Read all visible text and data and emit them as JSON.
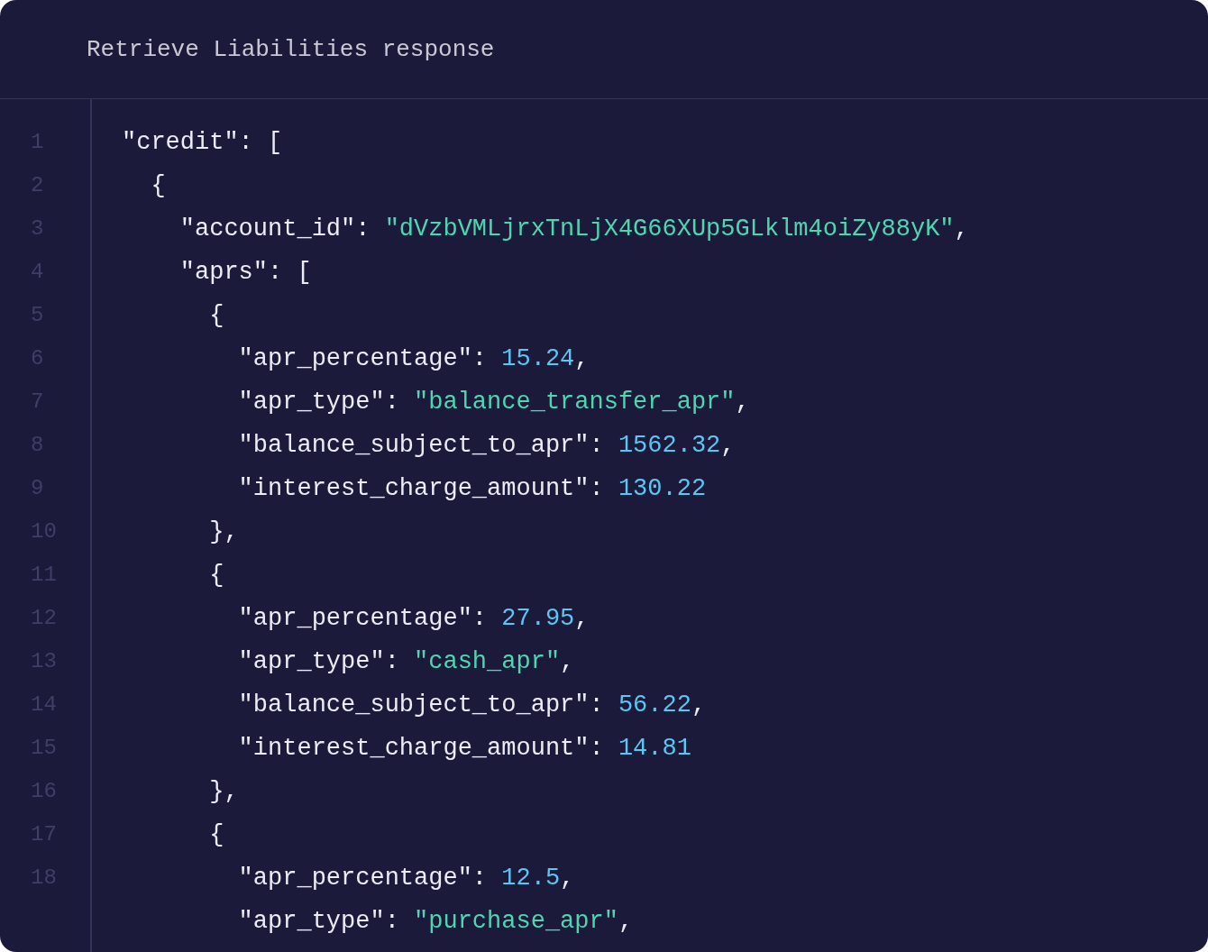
{
  "window": {
    "title": "Retrieve Liabilities response"
  },
  "code_lines": [
    {
      "number": "1",
      "tokens": [
        {
          "kind": "plain",
          "text": "\"credit\": ["
        }
      ]
    },
    {
      "number": "2",
      "tokens": [
        {
          "kind": "plain",
          "text": "  {"
        }
      ]
    },
    {
      "number": "3",
      "tokens": [
        {
          "kind": "plain",
          "text": "    \"account_id\": "
        },
        {
          "kind": "string",
          "text": "\"dVzbVMLjrxTnLjX4G66XUp5GLklm4oiZy88yK\""
        },
        {
          "kind": "plain",
          "text": ","
        }
      ]
    },
    {
      "number": "4",
      "tokens": [
        {
          "kind": "plain",
          "text": "    \"aprs\": ["
        }
      ]
    },
    {
      "number": "5",
      "tokens": [
        {
          "kind": "plain",
          "text": "      {"
        }
      ]
    },
    {
      "number": "6",
      "tokens": [
        {
          "kind": "plain",
          "text": "        \"apr_percentage\": "
        },
        {
          "kind": "number",
          "text": "15.24"
        },
        {
          "kind": "plain",
          "text": ","
        }
      ]
    },
    {
      "number": "7",
      "tokens": [
        {
          "kind": "plain",
          "text": "        \"apr_type\": "
        },
        {
          "kind": "string",
          "text": "\"balance_transfer_apr\""
        },
        {
          "kind": "plain",
          "text": ","
        }
      ]
    },
    {
      "number": "8",
      "tokens": [
        {
          "kind": "plain",
          "text": "        \"balance_subject_to_apr\": "
        },
        {
          "kind": "number",
          "text": "1562.32"
        },
        {
          "kind": "plain",
          "text": ","
        }
      ]
    },
    {
      "number": "9",
      "tokens": [
        {
          "kind": "plain",
          "text": "        \"interest_charge_amount\": "
        },
        {
          "kind": "number",
          "text": "130.22"
        }
      ]
    },
    {
      "number": "10",
      "tokens": [
        {
          "kind": "plain",
          "text": "      },"
        }
      ]
    },
    {
      "number": "11",
      "tokens": [
        {
          "kind": "plain",
          "text": "      {"
        }
      ]
    },
    {
      "number": "12",
      "tokens": [
        {
          "kind": "plain",
          "text": "        \"apr_percentage\": "
        },
        {
          "kind": "number",
          "text": "27.95"
        },
        {
          "kind": "plain",
          "text": ","
        }
      ]
    },
    {
      "number": "13",
      "tokens": [
        {
          "kind": "plain",
          "text": "        \"apr_type\": "
        },
        {
          "kind": "string",
          "text": "\"cash_apr\""
        },
        {
          "kind": "plain",
          "text": ","
        }
      ]
    },
    {
      "number": "14",
      "tokens": [
        {
          "kind": "plain",
          "text": "        \"balance_subject_to_apr\": "
        },
        {
          "kind": "number",
          "text": "56.22"
        },
        {
          "kind": "plain",
          "text": ","
        }
      ]
    },
    {
      "number": "15",
      "tokens": [
        {
          "kind": "plain",
          "text": "        \"interest_charge_amount\": "
        },
        {
          "kind": "number",
          "text": "14.81"
        }
      ]
    },
    {
      "number": "16",
      "tokens": [
        {
          "kind": "plain",
          "text": "      },"
        }
      ]
    },
    {
      "number": "17",
      "tokens": [
        {
          "kind": "plain",
          "text": "      {"
        }
      ]
    },
    {
      "number": "18",
      "tokens": [
        {
          "kind": "plain",
          "text": "        \"apr_percentage\": "
        },
        {
          "kind": "number",
          "text": "12.5"
        },
        {
          "kind": "plain",
          "text": ","
        }
      ]
    },
    {
      "tokens": [
        {
          "kind": "plain",
          "text": "        \"apr_type\": "
        },
        {
          "kind": "string",
          "text": "\"purchase_apr\""
        },
        {
          "kind": "plain",
          "text": ","
        }
      ]
    }
  ]
}
